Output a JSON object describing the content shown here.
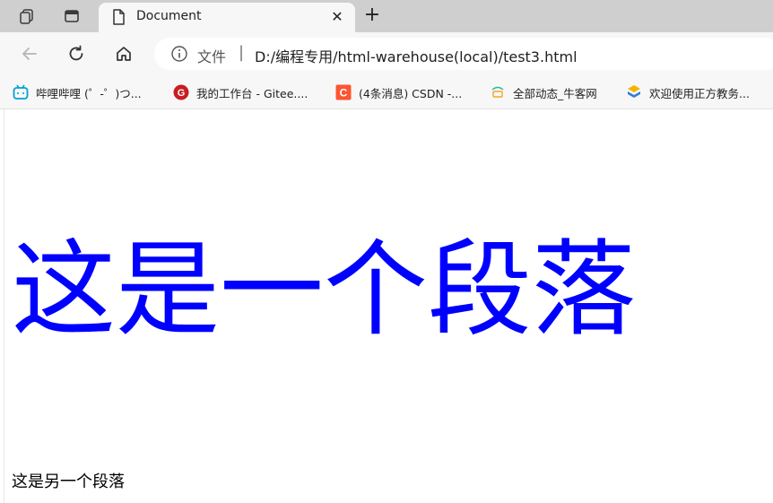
{
  "tab": {
    "title": "Document",
    "close_symbol": "✕"
  },
  "newtab_symbol": "+",
  "address": {
    "scheme": "文件",
    "separator": "|",
    "url": "D:/编程专用/html-warehouse(local)/test3.html"
  },
  "bookmarks": [
    {
      "label": "哔哩哔哩 (゜-゜)つ...",
      "icon": "bilibili-icon",
      "color": "#00a1d6"
    },
    {
      "label": "我的工作台 - Gitee....",
      "icon": "gitee-icon",
      "color": "#c71d23"
    },
    {
      "label": "(4条消息) CSDN -...",
      "icon": "csdn-icon",
      "color": "#fc5531"
    },
    {
      "label": "全部动态_牛客网",
      "icon": "nowcoder-icon",
      "color": "#25bb9b"
    },
    {
      "label": "欢迎使用正方教务...",
      "icon": "zhengfang-icon",
      "color": "#2f7ed8"
    }
  ],
  "content": {
    "heading": "这是一个段落",
    "paragraph": "这是另一个段落"
  },
  "colors": {
    "heading": "#0000ff",
    "tabbar": "#cfcfcf",
    "toolbar": "#f7f7f7"
  }
}
